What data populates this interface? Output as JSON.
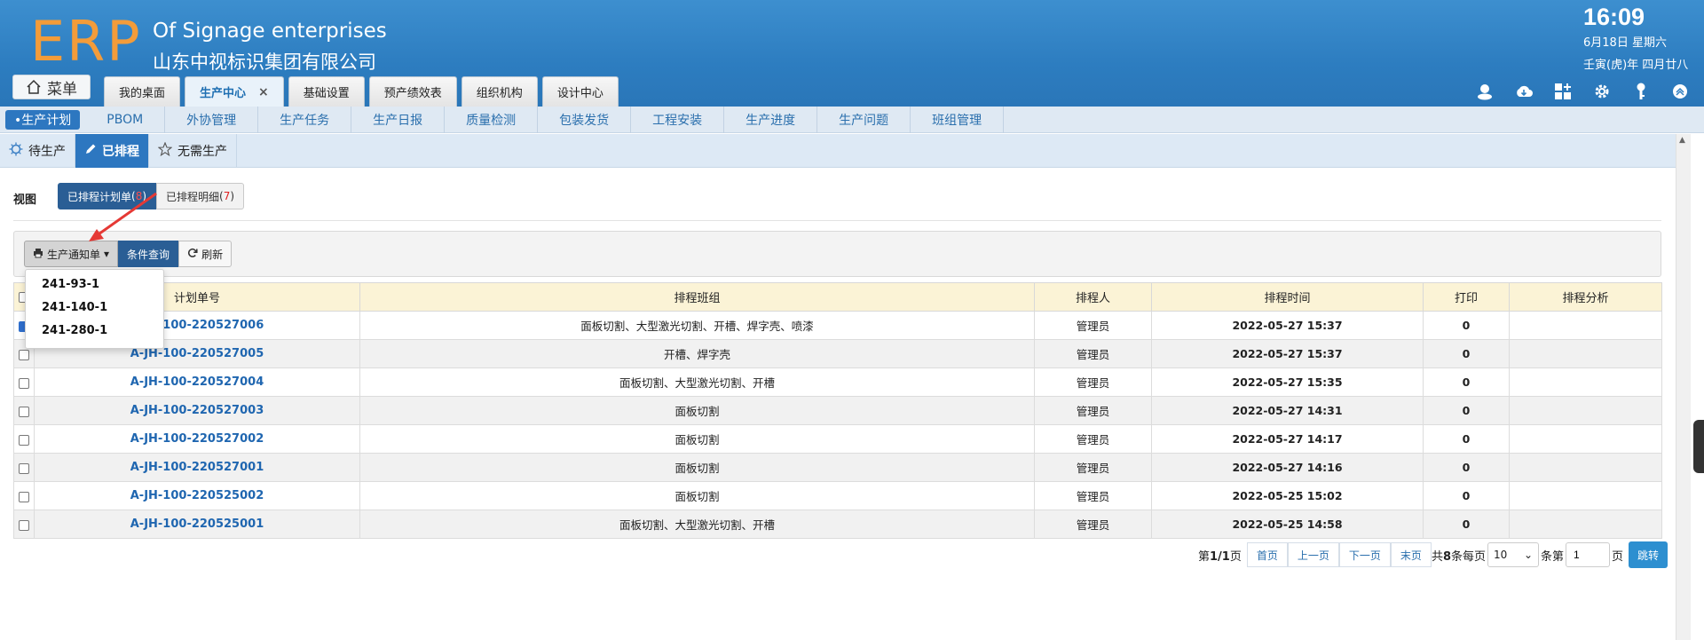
{
  "header": {
    "logo": "ERP",
    "company_en": "Of Signage enterprises",
    "company_cn": "山东中视标识集团有限公司",
    "time": "16:09",
    "date": "6月18日 星期六",
    "lunar": "壬寅(虎)年 四月廿八",
    "menu_label": "菜单"
  },
  "top_tabs": [
    {
      "label": "我的桌面"
    },
    {
      "label": "生产中心",
      "active": true
    },
    {
      "label": "基础设置"
    },
    {
      "label": "预产绩效表"
    },
    {
      "label": "组织机构"
    },
    {
      "label": "设计中心"
    }
  ],
  "top_icons": [
    "user-icon",
    "cloud-icon",
    "grid-add-icon",
    "gear-icon",
    "key-icon",
    "collapse-icon"
  ],
  "subnav": [
    {
      "label": "•生产计划",
      "active": true
    },
    {
      "label": "PBOM"
    },
    {
      "label": "外协管理"
    },
    {
      "label": "生产任务"
    },
    {
      "label": "生产日报"
    },
    {
      "label": "质量检测"
    },
    {
      "label": "包装发货"
    },
    {
      "label": "工程安装"
    },
    {
      "label": "生产进度"
    },
    {
      "label": "生产问题"
    },
    {
      "label": "班组管理"
    }
  ],
  "status_tabs": [
    {
      "label": "待生产",
      "icon": "gear-icon"
    },
    {
      "label": "已排程",
      "icon": "pencil-icon",
      "active": true
    },
    {
      "label": "无需生产",
      "icon": "star-icon"
    }
  ],
  "view": {
    "label": "视图",
    "btn_planned": "已排程计划单",
    "btn_planned_count": "8",
    "btn_detail": "已排程明细",
    "btn_detail_count": "7"
  },
  "toolbar": {
    "print_label": "生产通知单",
    "query_label": "条件查询",
    "refresh_label": "刷新"
  },
  "dropdown": [
    "241-93-1",
    "241-140-1",
    "241-280-1"
  ],
  "table": {
    "headers": [
      "",
      "计划单号",
      "排程班组",
      "排程人",
      "排程时间",
      "打印",
      "排程分析"
    ],
    "rows": [
      {
        "plan_no": "A-JH-100-220527006",
        "team": "面板切割、大型激光切割、开槽、焊字壳、喷漆",
        "person": "管理员",
        "time": "2022-05-27 15:37",
        "print": "0",
        "analysis": "",
        "checked": true
      },
      {
        "plan_no": "A-JH-100-220527005",
        "team": "开槽、焊字壳",
        "person": "管理员",
        "time": "2022-05-27 15:37",
        "print": "0",
        "analysis": ""
      },
      {
        "plan_no": "A-JH-100-220527004",
        "team": "面板切割、大型激光切割、开槽",
        "person": "管理员",
        "time": "2022-05-27 15:35",
        "print": "0",
        "analysis": ""
      },
      {
        "plan_no": "A-JH-100-220527003",
        "team": "面板切割",
        "person": "管理员",
        "time": "2022-05-27 14:31",
        "print": "0",
        "analysis": ""
      },
      {
        "plan_no": "A-JH-100-220527002",
        "team": "面板切割",
        "person": "管理员",
        "time": "2022-05-27 14:17",
        "print": "0",
        "analysis": ""
      },
      {
        "plan_no": "A-JH-100-220527001",
        "team": "面板切割",
        "person": "管理员",
        "time": "2022-05-27 14:16",
        "print": "0",
        "analysis": ""
      },
      {
        "plan_no": "A-JH-100-220525002",
        "team": "面板切割",
        "person": "管理员",
        "time": "2022-05-25 15:02",
        "print": "0",
        "analysis": ""
      },
      {
        "plan_no": "A-JH-100-220525001",
        "team": "面板切割、大型激光切割、开槽",
        "person": "管理员",
        "time": "2022-05-25 14:58",
        "print": "0",
        "analysis": ""
      }
    ]
  },
  "pager": {
    "page_info_pre": "第",
    "page_info_num": "1/1",
    "page_info_post": "页",
    "first": "首页",
    "prev": "上一页",
    "next": "下一页",
    "last": "末页",
    "total_pre": "共",
    "total_num": "8",
    "total_post": "条每页",
    "per_page": "10",
    "goto_pre": "条第",
    "goto_value": "1",
    "goto_post": "页",
    "go": "跳转"
  },
  "colors": {
    "header_blue": "#2d7dc0",
    "logo_orange": "#f39c3a",
    "active_blue": "#2d77c0",
    "link_blue": "#1f66b0",
    "table_header_bg": "#fbf3d6",
    "annotation_red": "#e53935"
  }
}
